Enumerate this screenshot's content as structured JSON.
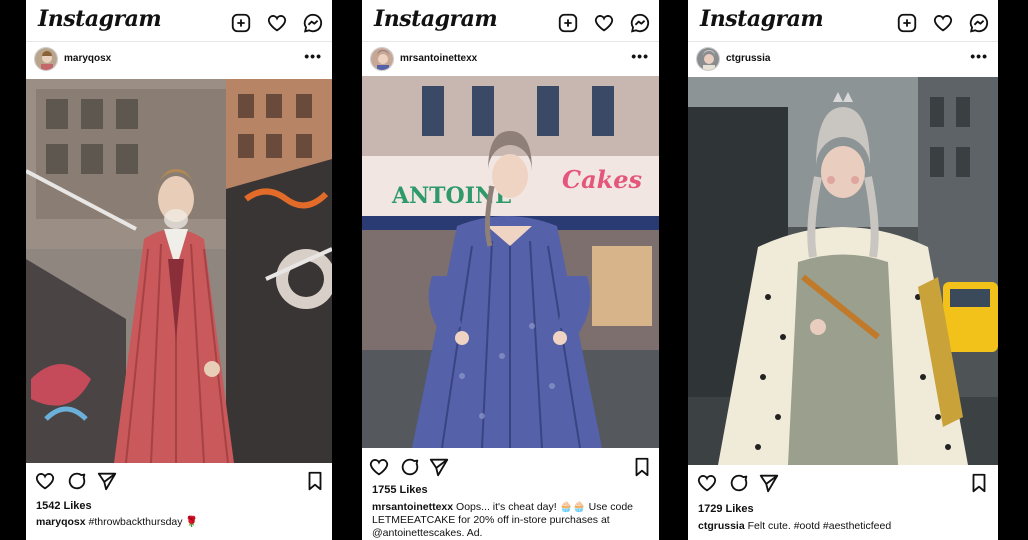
{
  "posts": [
    {
      "app_name": "Instagram",
      "username": "maryqosx",
      "likes": "1542 Likes",
      "caption_user": "maryqosx",
      "caption_text": "#throwbackthursday 🌹",
      "top_icons": [
        "new-post-icon",
        "heart-icon",
        "messenger-icon"
      ],
      "action_icons": [
        "like-icon",
        "comment-icon",
        "share-icon",
        "bookmark-icon"
      ]
    },
    {
      "app_name": "Instagram",
      "username": "mrsantoinettexx",
      "likes": "1755 Likes",
      "caption_user": "mrsantoinettexx",
      "caption_text": "Oops... it's cheat day! 🧁🧁 Use code LETMEEATCAKE for 20% off in-store purchases at @antoinettescakes. Ad.",
      "storefront_sign": "ANTOINETTE'S Cakes",
      "top_icons": [
        "new-post-icon",
        "heart-icon",
        "messenger-icon"
      ],
      "action_icons": [
        "like-icon",
        "comment-icon",
        "share-icon",
        "bookmark-icon"
      ]
    },
    {
      "app_name": "Instagram",
      "username": "ctgrussia",
      "likes": "1729 Likes",
      "caption_user": "ctgrussia",
      "caption_text": "Felt cute. #ootd #aestheticfeed",
      "top_icons": [
        "new-post-icon",
        "heart-icon",
        "messenger-icon"
      ],
      "action_icons": [
        "like-icon",
        "comment-icon",
        "share-icon",
        "bookmark-icon"
      ]
    }
  ],
  "colors": {
    "background": "#000000",
    "card": "#ffffff",
    "text": "#111111",
    "sign_green": "#2e9a6a",
    "sign_pink": "#e4567a",
    "dress_red": "#c9595b",
    "dress_blue": "#5561a8",
    "taxi_yellow": "#f2c21a"
  }
}
